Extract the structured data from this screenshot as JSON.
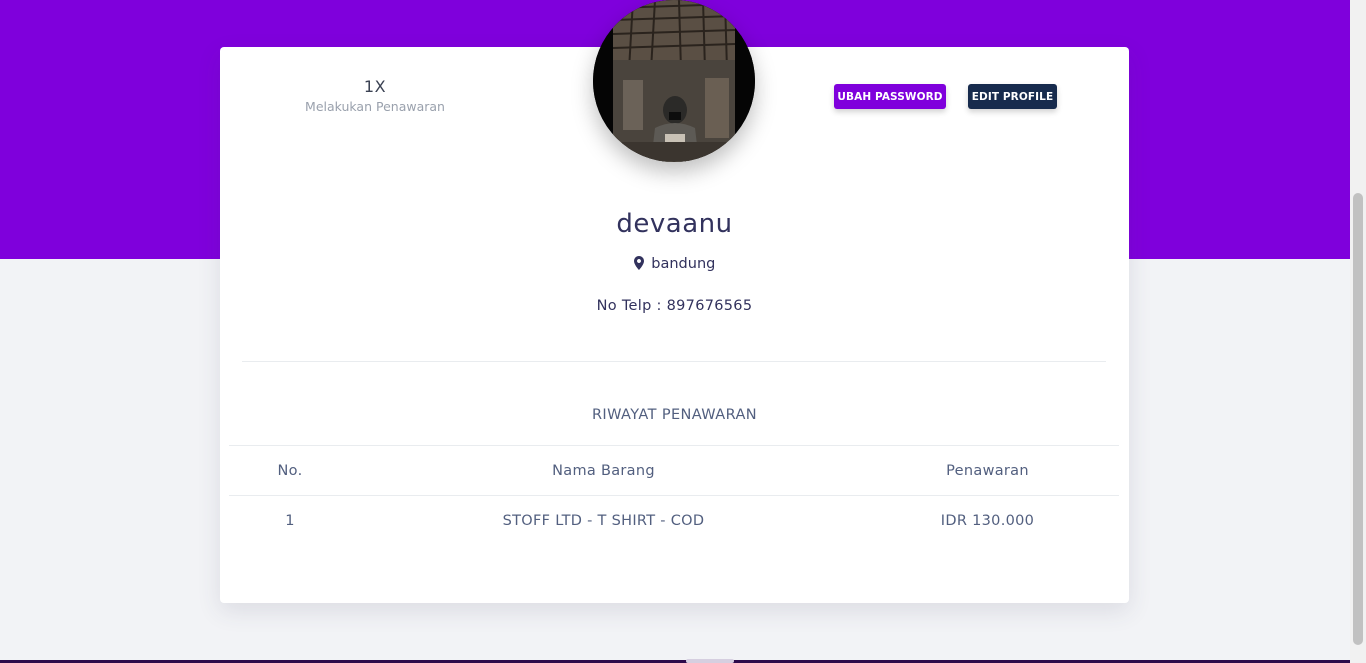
{
  "profile": {
    "stat_value": "1X",
    "stat_label": "Melakukan Penawaran",
    "username": "devaanu",
    "location": "bandung",
    "phone": "No Telp : 897676565"
  },
  "buttons": {
    "change_password": "UBAH PASSWORD",
    "edit_profile": "EDIT PROFILE"
  },
  "history": {
    "title": "RIWAYAT PENAWARAN",
    "columns": [
      "No.",
      "Nama Barang",
      "Penawaran"
    ],
    "rows": [
      [
        "1",
        "STOFF LTD - T SHIRT - COD",
        "IDR 130.000"
      ]
    ]
  },
  "colors": {
    "brand": "#7f00dc",
    "dark": "#172b4d"
  },
  "icons": {
    "location": "map-marker-icon"
  }
}
